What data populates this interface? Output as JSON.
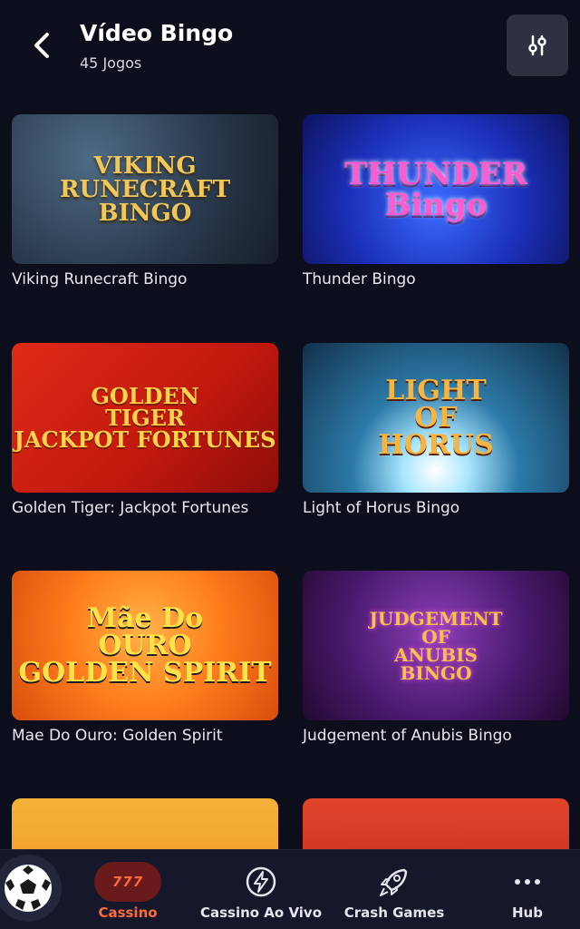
{
  "header": {
    "title": "Vídeo Bingo",
    "subtitle": "45 Jogos"
  },
  "games": [
    {
      "name": "Viking Runecraft Bingo",
      "logo": "VIKING\nRUNECRAFT\nBINGO"
    },
    {
      "name": "Thunder Bingo",
      "logo": "THUNDER\nBingo"
    },
    {
      "name": "Golden Tiger: Jackpot Fortunes",
      "logo": "GOLDEN\nTIGER\nJACKPOT FORTUNES"
    },
    {
      "name": "Light of Horus Bingo",
      "logo": "LIGHT\nOF\nHORUS"
    },
    {
      "name": "Mae Do Ouro: Golden Spirit",
      "logo": "Mãe Do\nOURO\nGOLDEN SPIRIT"
    },
    {
      "name": "Judgement of Anubis Bingo",
      "logo": "JUDGEMENT\nOF\nANUBIS\nBINGO"
    }
  ],
  "nav": {
    "items": [
      {
        "label": "Cassino",
        "icon_text": "777",
        "active": true
      },
      {
        "label": "Cassino Ao Vivo"
      },
      {
        "label": "Crash Games"
      },
      {
        "label": "Hub"
      }
    ]
  },
  "colors": {
    "background": "#0d0e1c",
    "accent": "#ff6a3c",
    "nav_bg": "#15172a"
  }
}
